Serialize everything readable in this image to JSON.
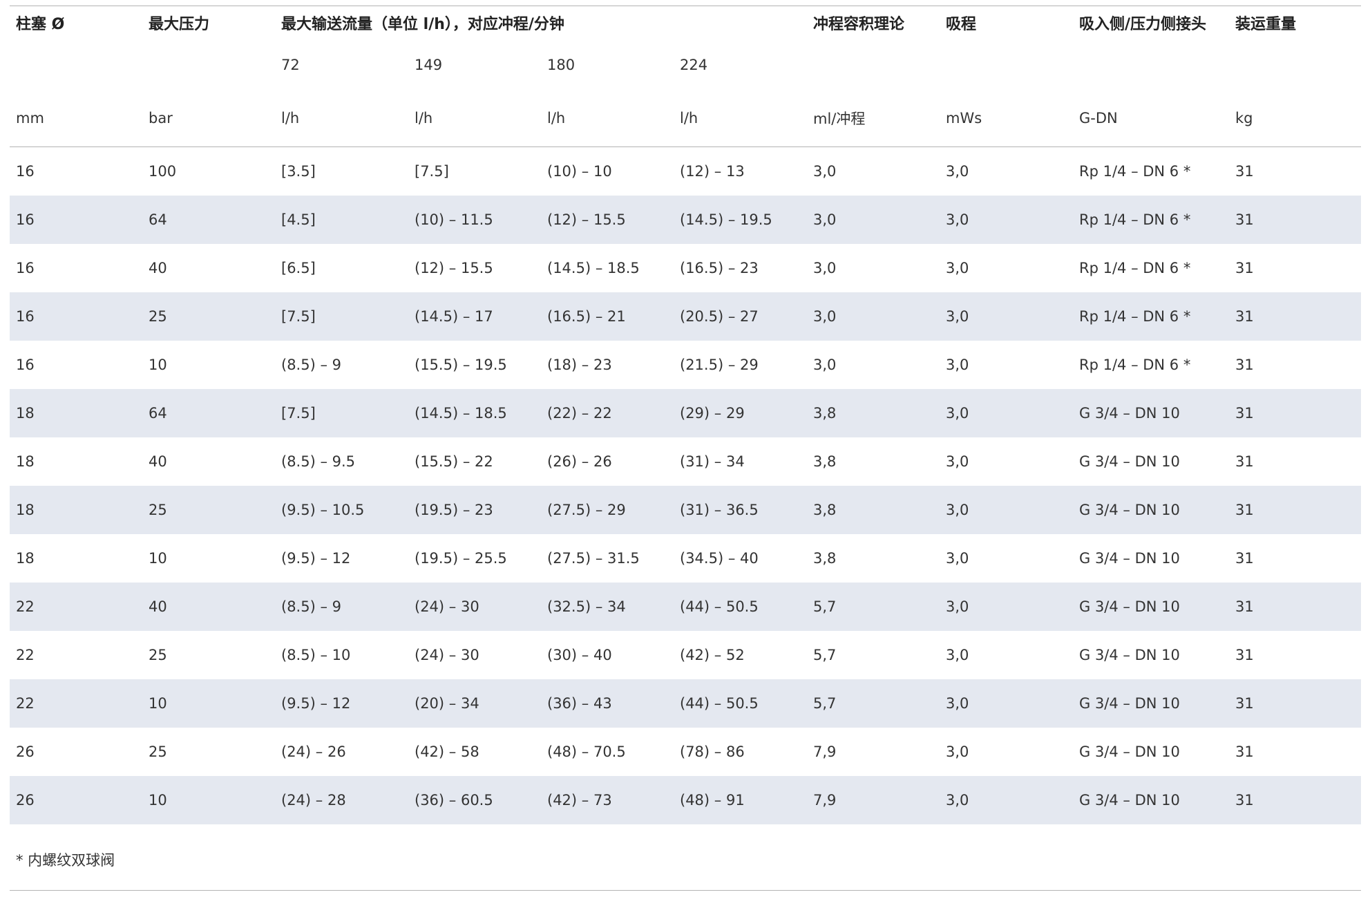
{
  "headers": {
    "row1": [
      "柱塞 Ø",
      "最大压力",
      "最大输送流量（单位 l/h），对应冲程/分钟",
      "冲程容积理论",
      "吸程",
      "吸入侧/压力侧接头",
      "装运重量"
    ],
    "row2_strokes": [
      "72",
      "149",
      "180",
      "224"
    ],
    "row3_units": [
      "mm",
      "bar",
      "l/h",
      "l/h",
      "l/h",
      "l/h",
      "ml/冲程",
      "mWs",
      "G-DN",
      "kg"
    ]
  },
  "rows": [
    [
      "16",
      "100",
      "[3.5]",
      "[7.5]",
      "(10) – 10",
      "(12) – 13",
      "3,0",
      "3,0",
      "Rp 1/4 – DN 6 *",
      "31"
    ],
    [
      "16",
      "64",
      "[4.5]",
      "(10) – 11.5",
      "(12) – 15.5",
      "(14.5) – 19.5",
      "3,0",
      "3,0",
      "Rp 1/4 – DN 6 *",
      "31"
    ],
    [
      "16",
      "40",
      "[6.5]",
      "(12) – 15.5",
      "(14.5) – 18.5",
      "(16.5) – 23",
      "3,0",
      "3,0",
      "Rp 1/4 – DN 6 *",
      "31"
    ],
    [
      "16",
      "25",
      "[7.5]",
      "(14.5) – 17",
      "(16.5) – 21",
      "(20.5) – 27",
      "3,0",
      "3,0",
      "Rp 1/4 – DN 6 *",
      "31"
    ],
    [
      "16",
      "10",
      "(8.5) – 9",
      "(15.5) – 19.5",
      "(18) – 23",
      "(21.5) – 29",
      "3,0",
      "3,0",
      "Rp 1/4 – DN 6 *",
      "31"
    ],
    [
      "18",
      "64",
      "[7.5]",
      "(14.5) – 18.5",
      "(22) – 22",
      "(29) – 29",
      "3,8",
      "3,0",
      "G 3/4 – DN 10",
      "31"
    ],
    [
      "18",
      "40",
      "(8.5) – 9.5",
      "(15.5) – 22",
      "(26) – 26",
      "(31) – 34",
      "3,8",
      "3,0",
      "G 3/4 – DN 10",
      "31"
    ],
    [
      "18",
      "25",
      "(9.5) – 10.5",
      "(19.5) – 23",
      "(27.5) – 29",
      "(31) – 36.5",
      "3,8",
      "3,0",
      "G 3/4 – DN 10",
      "31"
    ],
    [
      "18",
      "10",
      "(9.5) – 12",
      "(19.5) – 25.5",
      "(27.5) – 31.5",
      "(34.5) – 40",
      "3,8",
      "3,0",
      "G 3/4 – DN 10",
      "31"
    ],
    [
      "22",
      "40",
      "(8.5) – 9",
      "(24) – 30",
      "(32.5) – 34",
      "(44) – 50.5",
      "5,7",
      "3,0",
      "G 3/4 – DN 10",
      "31"
    ],
    [
      "22",
      "25",
      "(8.5) – 10",
      "(24) – 30",
      "(30) – 40",
      "(42) – 52",
      "5,7",
      "3,0",
      "G 3/4 – DN 10",
      "31"
    ],
    [
      "22",
      "10",
      "(9.5) – 12",
      "(20) – 34",
      "(36) – 43",
      "(44) – 50.5",
      "5,7",
      "3,0",
      "G 3/4 – DN 10",
      "31"
    ],
    [
      "26",
      "25",
      "(24) – 26",
      "(42) – 58",
      "(48) – 70.5",
      "(78) – 86",
      "7,9",
      "3,0",
      "G 3/4 – DN 10",
      "31"
    ],
    [
      "26",
      "10",
      "(24) – 28",
      "(36) – 60.5",
      "(42) – 73",
      "(48) – 91",
      "7,9",
      "3,0",
      "G 3/4 – DN 10",
      "31"
    ]
  ],
  "footnote": "* 内螺纹双球阀",
  "colors": {
    "stripe": "#e4e8f0",
    "rule": "#b3b3b3",
    "text": "#333333"
  }
}
